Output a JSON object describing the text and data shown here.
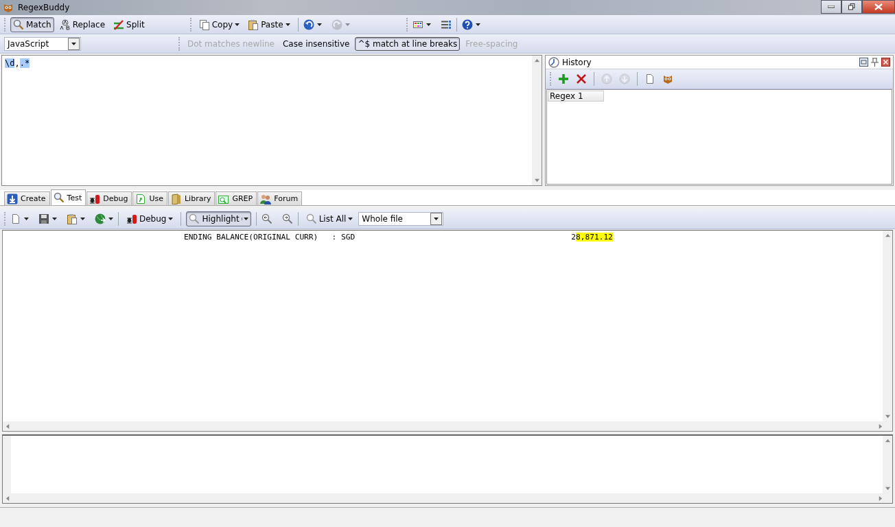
{
  "window": {
    "title": "RegexBuddy"
  },
  "main_toolbar": {
    "modes": [
      {
        "label": "Match",
        "kind": "match",
        "selected": true
      },
      {
        "label": "Replace",
        "kind": "replace",
        "selected": false
      },
      {
        "label": "Split",
        "kind": "split",
        "selected": false
      }
    ],
    "clipboard": [
      {
        "label": "Copy",
        "kind": "copy"
      },
      {
        "label": "Paste",
        "kind": "paste"
      }
    ],
    "history_buttons": [
      {
        "kind": "undo",
        "disabled": false
      },
      {
        "kind": "redo",
        "disabled": true
      }
    ]
  },
  "options_bar": {
    "flavor": "JavaScript",
    "options": [
      {
        "label": "Dot matches newline",
        "disabled": true,
        "on": false
      },
      {
        "label": "Case insensitive",
        "disabled": false,
        "on": false
      },
      {
        "label": "^$ match at line breaks",
        "disabled": false,
        "on": true
      },
      {
        "label": "Free-spacing",
        "disabled": true,
        "on": false
      }
    ]
  },
  "regex": [
    {
      "text": "\\d",
      "highlighted": true
    },
    {
      "text": ",",
      "highlighted": false
    },
    {
      "text": ".*",
      "highlighted": true
    }
  ],
  "history": {
    "title": "History",
    "tools": [
      {
        "kind": "add",
        "disabled": false
      },
      {
        "kind": "delete",
        "disabled": false
      },
      {
        "kind": "up",
        "disabled": true
      },
      {
        "kind": "down",
        "disabled": true
      },
      {
        "kind": "page",
        "disabled": false
      },
      {
        "kind": "mascot",
        "disabled": false
      }
    ],
    "items": [
      {
        "label": "Regex 1",
        "selected": true
      }
    ]
  },
  "tabs": [
    {
      "label": "Create",
      "kind": "create",
      "selected": false
    },
    {
      "label": "Test",
      "kind": "test",
      "selected": true
    },
    {
      "label": "Debug",
      "kind": "debug",
      "selected": false
    },
    {
      "label": "Use",
      "kind": "use",
      "selected": false
    },
    {
      "label": "Library",
      "kind": "library",
      "selected": false
    },
    {
      "label": "GREP",
      "kind": "grep",
      "selected": false
    },
    {
      "label": "Forum",
      "kind": "forum",
      "selected": false
    }
  ],
  "test_toolbar": {
    "debug": "Debug",
    "highlight": {
      "label": "Highlight",
      "on": true
    },
    "list_all": "List All",
    "scope": "Whole file"
  },
  "test_text": [
    [
      {
        "text": "ENDING BALANCE(ORIGINAL CURR)   : SGD",
        "kind": "label",
        "match": false
      },
      {
        "text": "2",
        "kind": "amount",
        "match": false
      },
      {
        "text": "8,871.12",
        "kind": "text",
        "match": true
      }
    ]
  ]
}
